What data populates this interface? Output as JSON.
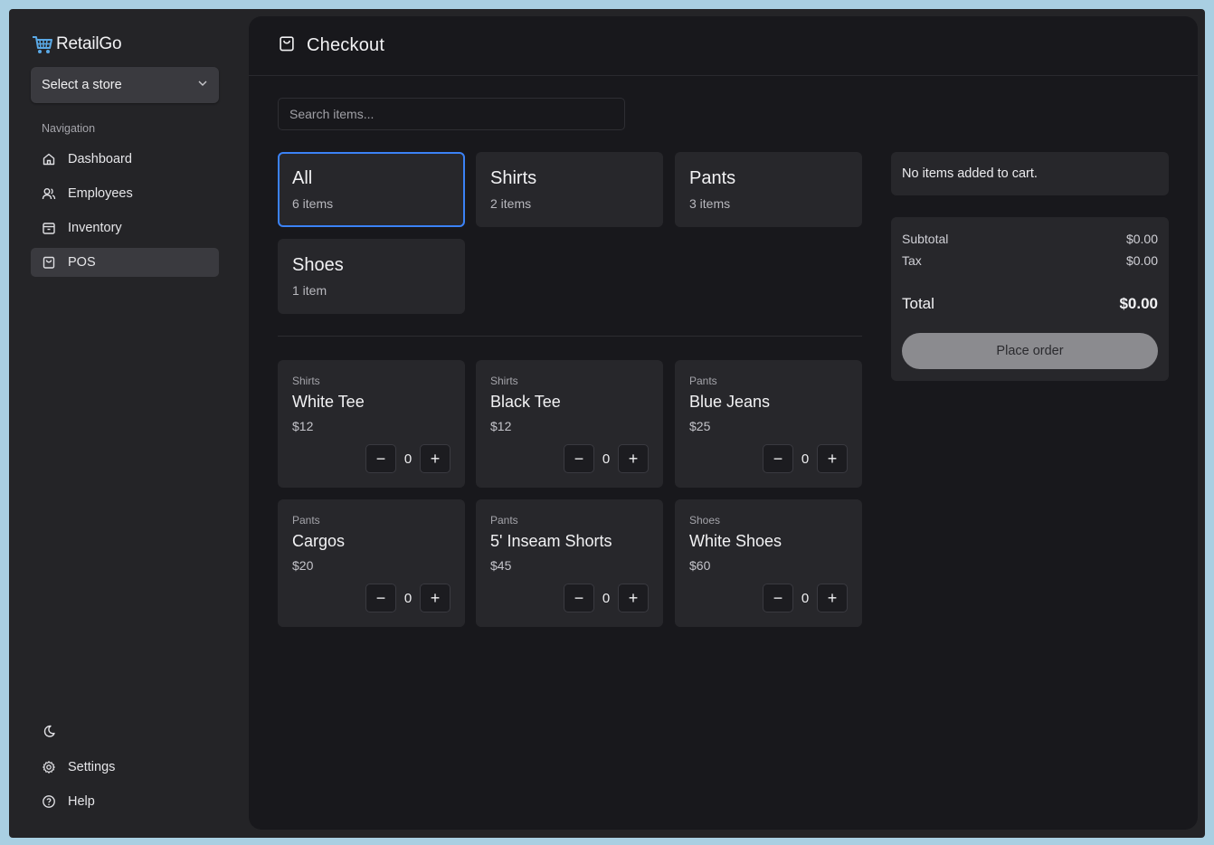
{
  "app": {
    "name": "RetailGo"
  },
  "sidebar": {
    "store_select": {
      "label": "Select a store"
    },
    "nav_heading": "Navigation",
    "items": [
      {
        "label": "Dashboard",
        "icon": "home-icon",
        "active": false
      },
      {
        "label": "Employees",
        "icon": "users-icon",
        "active": false
      },
      {
        "label": "Inventory",
        "icon": "box-icon",
        "active": false
      },
      {
        "label": "POS",
        "icon": "shopping-bag-icon",
        "active": true
      }
    ],
    "bottom": {
      "theme_icon": "moon-icon",
      "settings_label": "Settings",
      "help_label": "Help"
    }
  },
  "main": {
    "title": "Checkout",
    "search": {
      "placeholder": "Search items...",
      "value": ""
    },
    "categories": [
      {
        "name": "All",
        "count": "6 items",
        "active": true
      },
      {
        "name": "Shirts",
        "count": "2 items",
        "active": false
      },
      {
        "name": "Pants",
        "count": "3 items",
        "active": false
      },
      {
        "name": "Shoes",
        "count": "1 item",
        "active": false
      }
    ],
    "products": [
      {
        "category": "Shirts",
        "name": "White Tee",
        "price": "$12",
        "qty": "0"
      },
      {
        "category": "Shirts",
        "name": "Black Tee",
        "price": "$12",
        "qty": "0"
      },
      {
        "category": "Pants",
        "name": "Blue Jeans",
        "price": "$25",
        "qty": "0"
      },
      {
        "category": "Pants",
        "name": "Cargos",
        "price": "$20",
        "qty": "0"
      },
      {
        "category": "Pants",
        "name": "5' Inseam Shorts",
        "price": "$45",
        "qty": "0"
      },
      {
        "category": "Shoes",
        "name": "White Shoes",
        "price": "$60",
        "qty": "0"
      }
    ]
  },
  "cart": {
    "empty_message": "No items added to cart.",
    "subtotal_label": "Subtotal",
    "subtotal": "$0.00",
    "tax_label": "Tax",
    "tax": "$0.00",
    "total_label": "Total",
    "total": "$0.00",
    "place_order_label": "Place order"
  },
  "colors": {
    "accent": "#3b82f6",
    "background": "#18181c",
    "card": "#27272b"
  }
}
